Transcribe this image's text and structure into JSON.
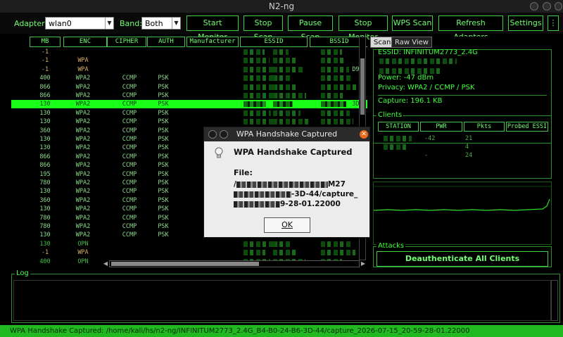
{
  "window": {
    "title": "N2-ng"
  },
  "toolbar": {
    "adapter_label": "Adapter:",
    "adapter_value": "wlan0",
    "band_label": "Band:",
    "band_value": "Both",
    "buttons": [
      "Start Monitor",
      "Stop Scan",
      "Pause Scan",
      "Stop Monitor",
      "WPS Scan",
      "Refresh Adapters",
      "Settings"
    ]
  },
  "table": {
    "columns": [
      "MB",
      "ENC",
      "CIPHER",
      "AUTH",
      "Manufacturer",
      "ESSID",
      "BSSID"
    ],
    "rows": [
      {
        "mb": "-1",
        "enc": "",
        "cipher": "",
        "auth": ""
      },
      {
        "mb": "-1",
        "enc": "WPA",
        "cipher": "",
        "auth": ""
      },
      {
        "mb": "-1",
        "enc": "WPA",
        "cipher": "",
        "auth": ""
      },
      {
        "mb": "400",
        "enc": "WPA2",
        "cipher": "CCMP",
        "auth": "PSK"
      },
      {
        "mb": "866",
        "enc": "WPA2",
        "cipher": "CCMP",
        "auth": "PSK"
      },
      {
        "mb": "866",
        "enc": "WPA2",
        "cipher": "CCMP",
        "auth": "PSK"
      },
      {
        "mb": "130",
        "enc": "WPA2",
        "cipher": "CCMP",
        "auth": "PSK"
      },
      {
        "mb": "130",
        "enc": "WPA2",
        "cipher": "CCMP",
        "auth": "PSK"
      },
      {
        "mb": "130",
        "enc": "WPA2",
        "cipher": "CCMP",
        "auth": "PSK"
      },
      {
        "mb": "360",
        "enc": "WPA2",
        "cipher": "CCMP",
        "auth": "PSK"
      },
      {
        "mb": "130",
        "enc": "WPA2",
        "cipher": "CCMP",
        "auth": "PSK"
      },
      {
        "mb": "130",
        "enc": "WPA2",
        "cipher": "CCMP",
        "auth": "PSK"
      },
      {
        "mb": "866",
        "enc": "WPA2",
        "cipher": "CCMP",
        "auth": "PSK"
      },
      {
        "mb": "866",
        "enc": "WPA2",
        "cipher": "CCMP",
        "auth": "PSK"
      },
      {
        "mb": "195",
        "enc": "WPA2",
        "cipher": "CCMP",
        "auth": "PSK"
      },
      {
        "mb": "780",
        "enc": "WPA2",
        "cipher": "CCMP",
        "auth": "PSK"
      },
      {
        "mb": "130",
        "enc": "WPA2",
        "cipher": "CCMP",
        "auth": "PSK"
      },
      {
        "mb": "360",
        "enc": "WPA2",
        "cipher": "CCMP",
        "auth": "PSK"
      },
      {
        "mb": "130",
        "enc": "WPA2",
        "cipher": "CCMP",
        "auth": "PSK"
      },
      {
        "mb": "780",
        "enc": "WPA2",
        "cipher": "CCMP",
        "auth": "PSK"
      },
      {
        "mb": "780",
        "enc": "WPA2",
        "cipher": "CCMP",
        "auth": "PSK"
      },
      {
        "mb": "130",
        "enc": "WPA2",
        "cipher": "CCMP",
        "auth": "PSK"
      },
      {
        "mb": "130",
        "enc": "OPN",
        "cipher": "",
        "auth": ""
      },
      {
        "mb": "-1",
        "enc": "WPA",
        "cipher": "",
        "auth": ""
      },
      {
        "mb": "400",
        "enc": "OPN",
        "cipher": "",
        "auth": ""
      }
    ],
    "selected_row": 6,
    "bssid_fragments": [
      "D9:",
      "3D:"
    ]
  },
  "right_panel": {
    "tabs": [
      "Scan",
      "Raw View"
    ],
    "essid_line": "ESSID: INFINITUM2773_2.4G",
    "power": "Power: -47 dBm",
    "privacy": "Privacy: WPA2 / CCMP / PSK",
    "capture": "Capture: 196.1 KB",
    "clients_title": "Clients",
    "client_columns": [
      "STATION",
      "PWR",
      "Pkts",
      "Probed ESSI"
    ],
    "client_values": [
      {
        "pwr": "-42",
        "pkts": "21"
      },
      {
        "pwr": "",
        "pkts": "4"
      },
      {
        "pwr": "-",
        "pkts": "24"
      }
    ],
    "attacks_title": "Attacks",
    "attack_button": "Deauthenticate All Clients"
  },
  "log": {
    "title": "Log"
  },
  "status_bar": "WPA Handshake Captured: /home/kali/hs/n2-ng/INFINITUM2773_2.4G_B4-B0-24-B6-3D-44/capture_2026-07-15_20-59-28-01.22000",
  "dialog": {
    "title": "WPA Handshake Captured",
    "heading": "WPA Handshake Captured",
    "file_label": "File:",
    "path_line1_end": "M27",
    "path_line2": "-3D-44/capture_",
    "path_line3": "9-28-01.22000",
    "ok_label": "OK"
  },
  "colors": {
    "accent": "#3ecf3e",
    "highlight": "#1aff1a",
    "status_bar": "#21b821"
  }
}
